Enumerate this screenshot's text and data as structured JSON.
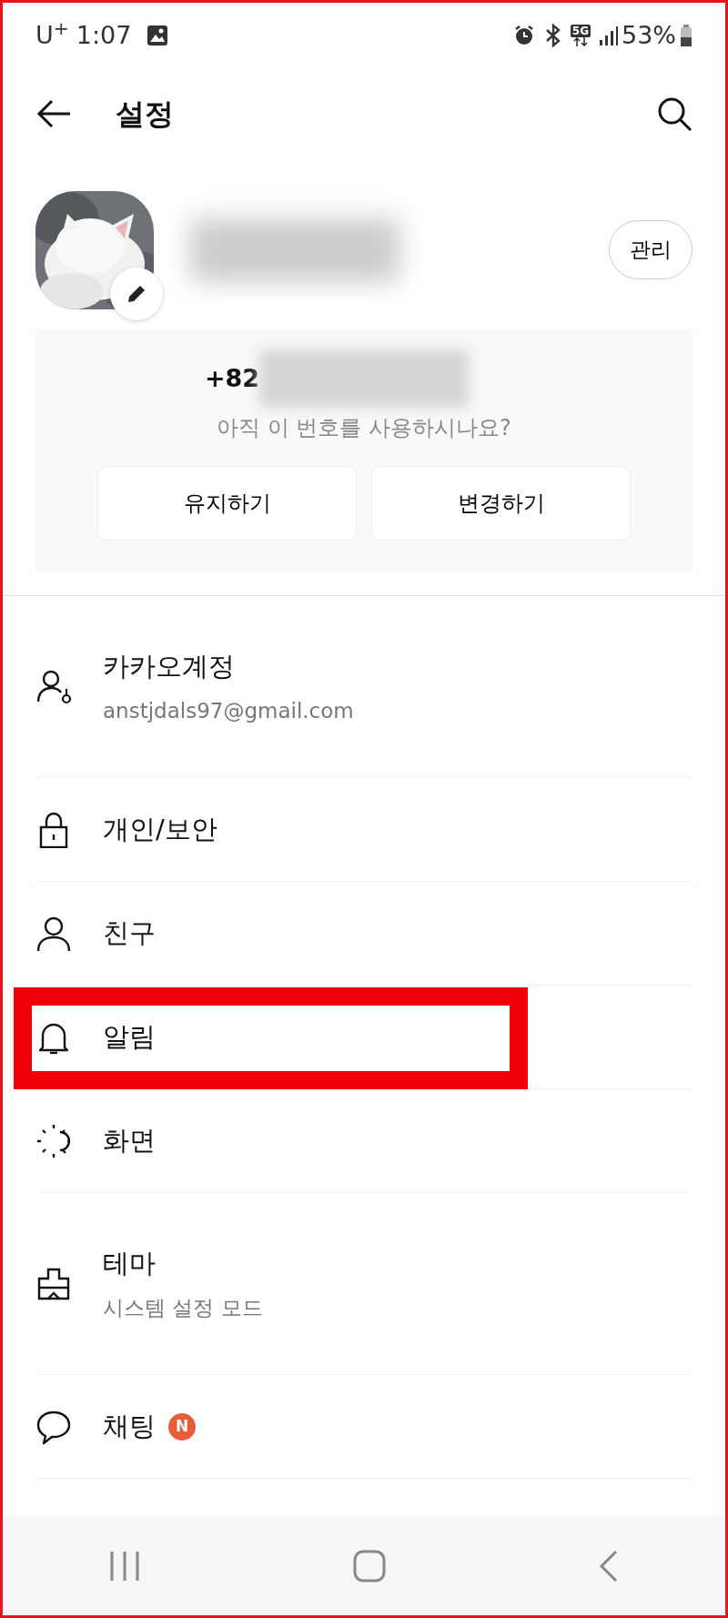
{
  "status_bar": {
    "carrier": "U$^{+}$",
    "time": "1:07",
    "network": "5G",
    "battery": "53%"
  },
  "header": {
    "title": "설정"
  },
  "profile": {
    "manage_button": "관리"
  },
  "phone_card": {
    "prefix": "+82",
    "question": "아직 이 번호를 사용하시나요?",
    "buttons": [
      "유지하기",
      "변경하기"
    ]
  },
  "items": [
    {
      "label": "카카오계정",
      "subtitle": "anstjdals97@gmail.com",
      "highlighted": false
    },
    {
      "label": "개인/보안",
      "highlighted": false
    },
    {
      "label": "친구",
      "highlighted": false
    },
    {
      "label": "알림",
      "highlighted": true
    },
    {
      "label": "화면",
      "highlighted": false
    },
    {
      "label": "테마",
      "subtitle": "시스템 설정 모드",
      "highlighted": false
    },
    {
      "label": "채팅",
      "badge": {
        "text": "N",
        "color": "#e65c3c"
      },
      "highlighted": false
    }
  ]
}
